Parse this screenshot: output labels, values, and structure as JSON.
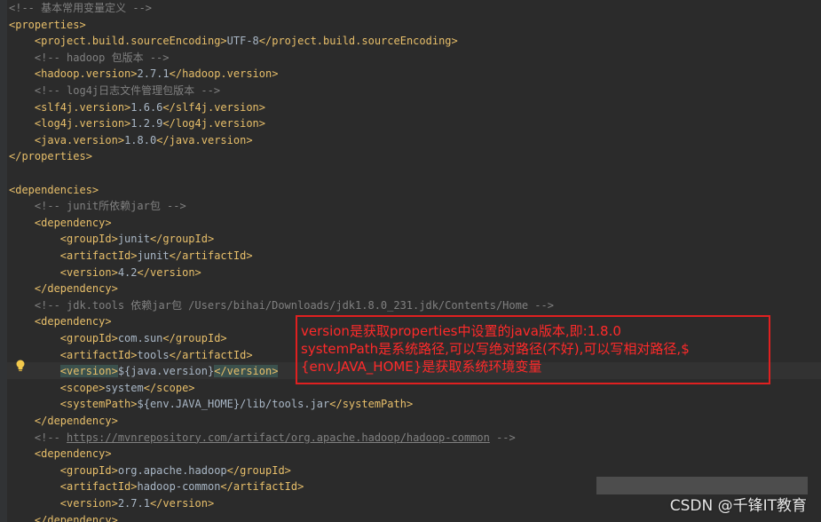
{
  "lines": [
    [
      {
        "c": "comment",
        "t": "<!-- 基本常用变量定义 -->"
      }
    ],
    [
      {
        "c": "tag",
        "t": "<properties>"
      }
    ],
    [
      {
        "c": "text",
        "t": "    "
      },
      {
        "c": "tag",
        "t": "<project.build.sourceEncoding>"
      },
      {
        "c": "text",
        "t": "UTF-8"
      },
      {
        "c": "tag",
        "t": "</project.build.sourceEncoding>"
      }
    ],
    [
      {
        "c": "text",
        "t": "    "
      },
      {
        "c": "comment",
        "t": "<!-- hadoop 包版本 -->"
      }
    ],
    [
      {
        "c": "text",
        "t": "    "
      },
      {
        "c": "tag",
        "t": "<hadoop.version>"
      },
      {
        "c": "text",
        "t": "2.7.1"
      },
      {
        "c": "tag",
        "t": "</hadoop.version>"
      }
    ],
    [
      {
        "c": "text",
        "t": "    "
      },
      {
        "c": "comment",
        "t": "<!-- log4j日志文件管理包版本 -->"
      }
    ],
    [
      {
        "c": "text",
        "t": "    "
      },
      {
        "c": "tag",
        "t": "<slf4j.version>"
      },
      {
        "c": "text",
        "t": "1.6.6"
      },
      {
        "c": "tag",
        "t": "</slf4j.version>"
      }
    ],
    [
      {
        "c": "text",
        "t": "    "
      },
      {
        "c": "tag",
        "t": "<log4j.version>"
      },
      {
        "c": "text",
        "t": "1.2.9"
      },
      {
        "c": "tag",
        "t": "</log4j.version>"
      }
    ],
    [
      {
        "c": "text",
        "t": "    "
      },
      {
        "c": "tag",
        "t": "<java.version>"
      },
      {
        "c": "text",
        "t": "1.8.0"
      },
      {
        "c": "tag",
        "t": "</java.version>"
      }
    ],
    [
      {
        "c": "tag",
        "t": "</properties>"
      }
    ],
    [],
    [
      {
        "c": "tag",
        "t": "<dependencies>"
      }
    ],
    [
      {
        "c": "text",
        "t": "    "
      },
      {
        "c": "comment",
        "t": "<!-- junit所依赖jar包 -->"
      }
    ],
    [
      {
        "c": "text",
        "t": "    "
      },
      {
        "c": "tag",
        "t": "<dependency>"
      }
    ],
    [
      {
        "c": "text",
        "t": "        "
      },
      {
        "c": "tag",
        "t": "<groupId>"
      },
      {
        "c": "text",
        "t": "junit"
      },
      {
        "c": "tag",
        "t": "</groupId>"
      }
    ],
    [
      {
        "c": "text",
        "t": "        "
      },
      {
        "c": "tag",
        "t": "<artifactId>"
      },
      {
        "c": "text",
        "t": "junit"
      },
      {
        "c": "tag",
        "t": "</artifactId>"
      }
    ],
    [
      {
        "c": "text",
        "t": "        "
      },
      {
        "c": "tag",
        "t": "<version>"
      },
      {
        "c": "text",
        "t": "4.2"
      },
      {
        "c": "tag",
        "t": "</version>"
      }
    ],
    [
      {
        "c": "text",
        "t": "    "
      },
      {
        "c": "tag",
        "t": "</dependency>"
      }
    ],
    [
      {
        "c": "text",
        "t": "    "
      },
      {
        "c": "comment",
        "t": "<!-- jdk.tools 依赖jar包 /Users/bihai/Downloads/jdk1.8.0_231.jdk/Contents/Home -->"
      }
    ],
    [
      {
        "c": "text",
        "t": "    "
      },
      {
        "c": "tag",
        "t": "<dependency>"
      }
    ],
    [
      {
        "c": "text",
        "t": "        "
      },
      {
        "c": "tag",
        "t": "<groupId>"
      },
      {
        "c": "text",
        "t": "com.sun"
      },
      {
        "c": "tag",
        "t": "</groupId>"
      }
    ],
    [
      {
        "c": "text",
        "t": "        "
      },
      {
        "c": "tag",
        "t": "<artifactId>"
      },
      {
        "c": "text",
        "t": "tools"
      },
      {
        "c": "tag",
        "t": "</artifactId>"
      }
    ],
    [
      {
        "c": "text",
        "t": "        "
      },
      {
        "c": "tag hl",
        "t": "<version>"
      },
      {
        "c": "text",
        "t": "${java.version}"
      },
      {
        "c": "tag hl",
        "t": "</version>"
      }
    ],
    [
      {
        "c": "text",
        "t": "        "
      },
      {
        "c": "tag",
        "t": "<scope>"
      },
      {
        "c": "text",
        "t": "system"
      },
      {
        "c": "tag",
        "t": "</scope>"
      }
    ],
    [
      {
        "c": "text",
        "t": "        "
      },
      {
        "c": "tag",
        "t": "<systemPath>"
      },
      {
        "c": "text",
        "t": "${env.JAVA_HOME}/lib/tools.jar"
      },
      {
        "c": "tag",
        "t": "</systemPath>"
      }
    ],
    [
      {
        "c": "text",
        "t": "    "
      },
      {
        "c": "tag",
        "t": "</dependency>"
      }
    ],
    [
      {
        "c": "text",
        "t": "    "
      },
      {
        "c": "comment",
        "t": "<!-- "
      },
      {
        "c": "link",
        "t": "https://mvnrepository.com/artifact/org.apache.hadoop/hadoop-common"
      },
      {
        "c": "comment",
        "t": " -->"
      }
    ],
    [
      {
        "c": "text",
        "t": "    "
      },
      {
        "c": "tag",
        "t": "<dependency>"
      }
    ],
    [
      {
        "c": "text",
        "t": "        "
      },
      {
        "c": "tag",
        "t": "<groupId>"
      },
      {
        "c": "text",
        "t": "org.apache.hadoop"
      },
      {
        "c": "tag",
        "t": "</groupId>"
      }
    ],
    [
      {
        "c": "text",
        "t": "        "
      },
      {
        "c": "tag",
        "t": "<artifactId>"
      },
      {
        "c": "text",
        "t": "hadoop-common"
      },
      {
        "c": "tag",
        "t": "</artifactId>"
      }
    ],
    [
      {
        "c": "text",
        "t": "        "
      },
      {
        "c": "tag",
        "t": "<version>"
      },
      {
        "c": "text",
        "t": "2.7.1"
      },
      {
        "c": "tag",
        "t": "</version>"
      }
    ],
    [
      {
        "c": "text",
        "t": "    "
      },
      {
        "c": "tag",
        "t": "</dependency>"
      }
    ]
  ],
  "annotation": {
    "line1": "version是获取properties中设置的java版本,即:1.8.0",
    "line2": "systemPath是系统路径,可以写绝对路径(不好),可以写相对路径,$",
    "line3": "{env.JAVA_HOME}是获取系统环境变量"
  },
  "watermark": "CSDN @千锋IT教育",
  "colors": {
    "background": "#2b2b2b",
    "tag": "#e8bf6a",
    "text": "#a9b7c6",
    "comment": "#808080",
    "annotation": "#e02020"
  },
  "icons": {
    "intention": "lightbulb-icon"
  }
}
